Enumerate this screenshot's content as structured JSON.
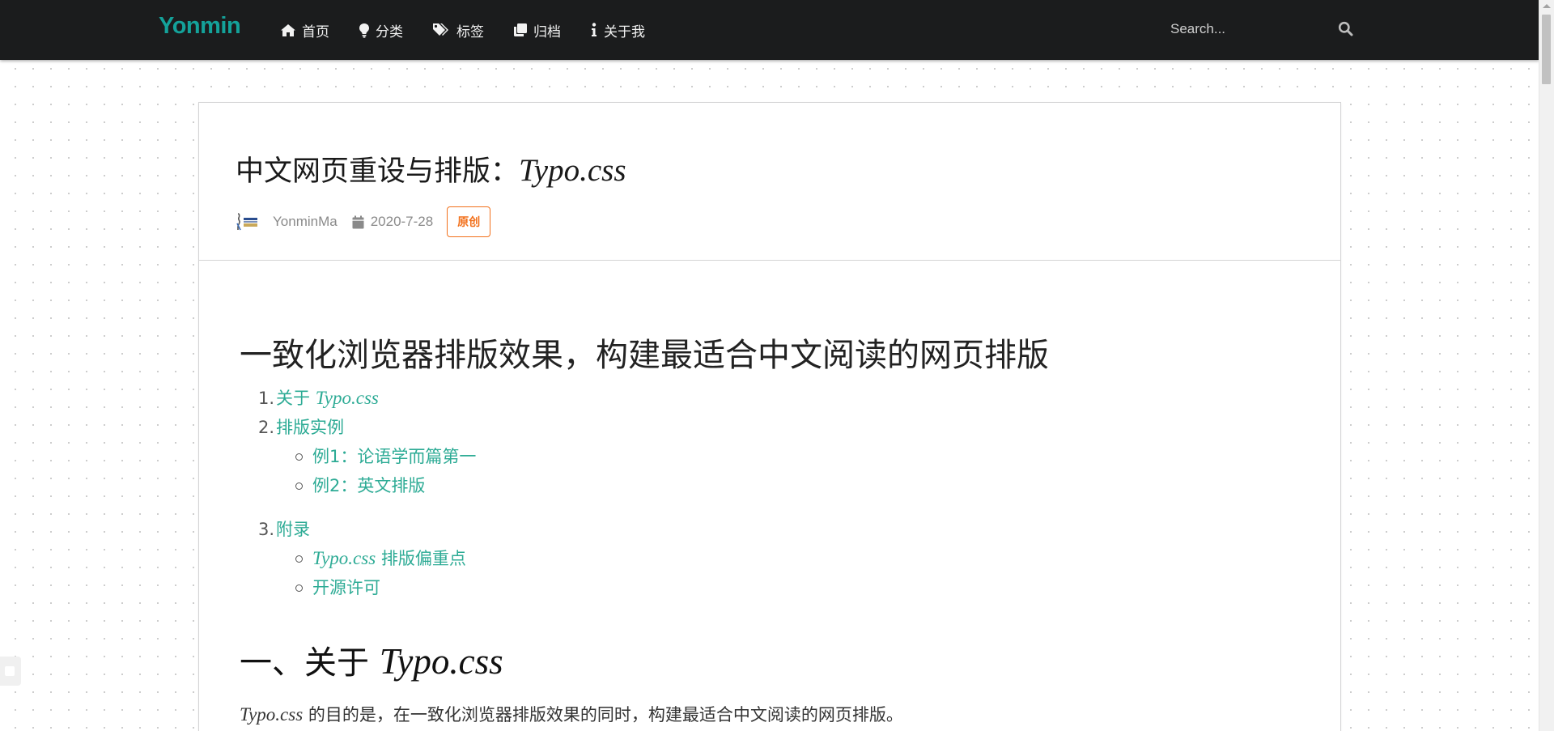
{
  "navbar": {
    "brand": "Yonmin",
    "items": [
      {
        "label": "首页",
        "icon": "home-icon"
      },
      {
        "label": "分类",
        "icon": "lightbulb-icon"
      },
      {
        "label": "标签",
        "icon": "tags-icon"
      },
      {
        "label": "归档",
        "icon": "clone-icon"
      },
      {
        "label": "关于我",
        "icon": "info-icon"
      }
    ],
    "search": {
      "placeholder": "Search...",
      "value": ""
    },
    "colors": {
      "background": "#1b1c1d",
      "brand": "#14a29a"
    }
  },
  "post": {
    "title_cn": "中文网页重设与排版：",
    "title_typo": "Typo.css",
    "author": "YonminMa",
    "date": "2020-7-28",
    "badge": "原创",
    "badge_color": "#f2711c"
  },
  "content": {
    "h1": "一致化浏览器排版效果，构建最适合中文阅读的网页排版",
    "toc": {
      "item1": {
        "num": "1.",
        "prefix": "关于 ",
        "typo": "Typo.css"
      },
      "item2": {
        "num": "2.",
        "label": "排版实例"
      },
      "item2_sub": [
        "例1：论语学而篇第一",
        "例2：英文排版"
      ],
      "item3": {
        "num": "3.",
        "label": "附录"
      },
      "item3_sub1": {
        "typo": "Typo.css",
        "suffix": " 排版偏重点"
      },
      "item3_sub2": "开源许可"
    },
    "h2": {
      "prefix": "一、关于 ",
      "typo": "Typo.css"
    },
    "para": {
      "typo": "Typo.css",
      "text": " 的目的是，在一致化浏览器排版效果的同时，构建最适合中文阅读的网页排版。"
    },
    "link_color": "#2dab95"
  }
}
